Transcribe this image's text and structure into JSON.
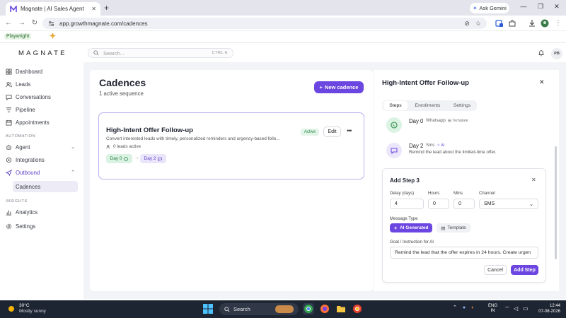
{
  "browser": {
    "tab_title": "Magnate | AI Sales Agent",
    "url": "app.growthmagnate.com/cadences",
    "gemini_label": "Ask Gemini",
    "bookmark": "Playwright"
  },
  "app": {
    "logo": "MAGNATE",
    "search_placeholder": "Search...",
    "search_shortcut": "CTRL K",
    "avatar_initials": "PB"
  },
  "sidebar": {
    "items": [
      {
        "label": "Dashboard",
        "icon": "grid-icon"
      },
      {
        "label": "Leads",
        "icon": "users-icon"
      },
      {
        "label": "Conversations",
        "icon": "chat-icon"
      },
      {
        "label": "Pipeline",
        "icon": "pipeline-icon"
      },
      {
        "label": "Appointments",
        "icon": "calendar-icon"
      }
    ],
    "section_automation": "AUTOMATION",
    "automation_items": [
      {
        "label": "Agent",
        "icon": "agent-icon"
      },
      {
        "label": "Integrations",
        "icon": "plug-icon"
      },
      {
        "label": "Outbound",
        "icon": "send-icon"
      }
    ],
    "sub_item": "Cadences",
    "section_insights": "INSIGHTS",
    "insight_items": [
      {
        "label": "Analytics",
        "icon": "chart-icon"
      },
      {
        "label": "Settings",
        "icon": "gear-icon"
      }
    ]
  },
  "main": {
    "title": "Cadences",
    "subtitle": "1 active sequence",
    "new_button": "New cadence",
    "cadence": {
      "name": "High-Intent Offer Follow-up",
      "description": "Convert interested leads with timely, personalized reminders and urgency-based follo...",
      "leads": "0 leads active",
      "status": "Active",
      "edit_label": "Edit",
      "chips": [
        {
          "label": "Day 0",
          "channel": "whatsapp"
        },
        {
          "label": "Day 2",
          "channel": "sms"
        }
      ]
    }
  },
  "panel": {
    "title": "High-Intent Offer Follow-up",
    "tabs": [
      "Steps",
      "Enrollments",
      "Settings"
    ],
    "active_tab": "Steps",
    "steps": [
      {
        "day": "Day 0",
        "channel": "Whatsapp",
        "tag": "Template",
        "description": ""
      },
      {
        "day": "Day 2",
        "channel": "Sms",
        "tag": "AI",
        "description": "Remind the lead about the limited-time offer."
      }
    ],
    "add_step": {
      "title": "Add Step 3",
      "delay_label": "Delay (days)",
      "delay_value": "4",
      "hours_label": "Hours",
      "hours_value": "0",
      "mins_label": "Mins",
      "mins_value": "0",
      "channel_label": "Channel",
      "channel_value": "SMS",
      "message_type_label": "Message Type",
      "message_type_ai": "AI Generated",
      "message_type_template": "Template",
      "goal_label": "Goal / Instruction for AI",
      "goal_value": "Remind the lead that the offer expires in 24 hours. Create urgen",
      "cancel_label": "Cancel",
      "submit_label": "Add Step"
    }
  },
  "taskbar": {
    "temperature": "30°C",
    "condition": "Mostly sunny",
    "search_label": "Search",
    "lang_top": "ENG",
    "lang_bottom": "IN",
    "time": "12:44",
    "date": "07-08-2026"
  },
  "colors": {
    "accent": "#6b46e0",
    "active_green": "#2e8a48"
  }
}
